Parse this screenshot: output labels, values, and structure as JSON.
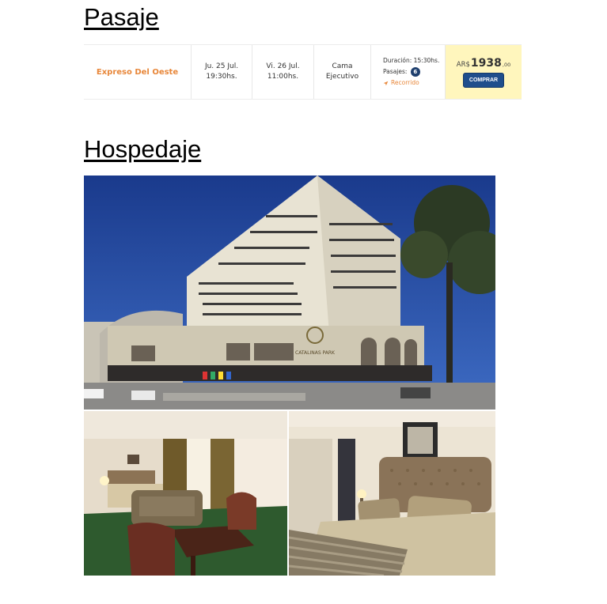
{
  "sections": {
    "transport_title": "Pasaje",
    "lodging_title": "Hospedaje"
  },
  "ticket": {
    "company": "Expreso Del Oeste",
    "departure": {
      "day": "Ju. 25 Jul.",
      "time": "19:30hs."
    },
    "arrival": {
      "day": "Vi. 26 Jul.",
      "time": "11:00hs."
    },
    "seat_type": {
      "line1": "Cama",
      "line2": "Ejecutivo"
    },
    "duration": "Duración: 15:30hs.",
    "passengers_label": "Pasajes:",
    "passengers_count": "6",
    "route_link": "Recorrido",
    "currency": "AR$",
    "price_int": "1938",
    "price_dec": ",00",
    "buy_label": "COMPRAR"
  },
  "colors": {
    "company": "#e8873a",
    "price_bg": "#fff6bd",
    "button": "#1f4e8c",
    "badge": "#1f3f6e"
  },
  "gallery": {
    "hotel_sign": "CATALINAS PARK"
  }
}
